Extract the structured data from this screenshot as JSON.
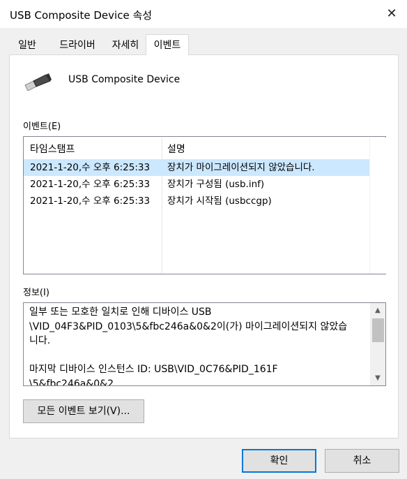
{
  "window": {
    "title": "USB Composite Device 속성",
    "close_label": "✕"
  },
  "tabs": [
    {
      "label": "일반",
      "active": false
    },
    {
      "label": "드라이버",
      "active": false
    },
    {
      "label": "자세히",
      "active": false
    },
    {
      "label": "이벤트",
      "active": true
    }
  ],
  "device": {
    "name": "USB Composite Device",
    "icon": "usb-plug-icon"
  },
  "events": {
    "label": "이벤트(E)",
    "columns": [
      "타임스탬프",
      "설명"
    ],
    "rows": [
      {
        "timestamp": "2021-1-20,수 오후 6:25:33",
        "description": "장치가 마이그레이션되지 않았습니다.",
        "selected": true
      },
      {
        "timestamp": "2021-1-20,수 오후 6:25:33",
        "description": "장치가 구성됨 (usb.inf)",
        "selected": false
      },
      {
        "timestamp": "2021-1-20,수 오후 6:25:33",
        "description": "장치가 시작됨 (usbccgp)",
        "selected": false
      }
    ]
  },
  "info": {
    "label": "정보(I)",
    "text": "일부 또는 모호한 일치로 인해 디바이스 USB\n\\VID_04F3&PID_0103\\5&fbc246a&0&2이(가) 마이그레이션되지 않았습\n니다.\n\n마지막 디바이스 인스턴스 ID: USB\\VID_0C76&PID_161F\n\\5&fbc246a&0&2"
  },
  "buttons": {
    "view_all": "모든 이벤트 보기(V)...",
    "ok": "확인",
    "cancel": "취소"
  },
  "colors": {
    "selection": "#cce8ff",
    "accent": "#0078d7"
  }
}
